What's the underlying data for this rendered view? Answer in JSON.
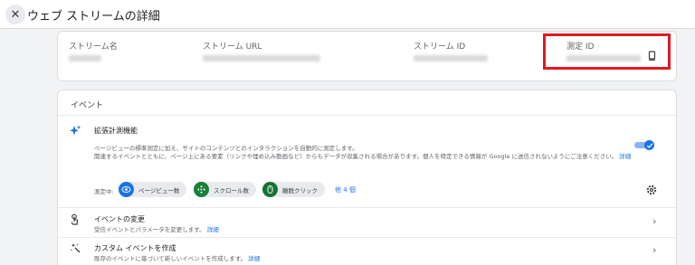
{
  "header": {
    "title": "ウェブ ストリームの詳細",
    "close_icon": "close-icon"
  },
  "stream": {
    "fields": [
      {
        "label": "ストリーム名"
      },
      {
        "label": "ストリーム URL"
      },
      {
        "label": "ストリーム ID"
      },
      {
        "label": "測定 ID"
      }
    ]
  },
  "events": {
    "title": "イベント",
    "enhanced": {
      "title": "拡張計測機能",
      "desc1": "ページビューの標準測定に加え、サイトのコンテンツとのインタラクションを自動的に測定します。",
      "desc2": "関連するイベントとともに、ページ上にある要素（リンクや埋め込み動画など）からもデータが収集される場合があります。個人を特定できる情報が Google に送信されないようにご注意ください。",
      "detail_link": "詳細",
      "toggle_on": true,
      "measuring_label": "測定中:",
      "chips": [
        {
          "label": "ページビュー数",
          "icon": "eye-icon",
          "color": "#1a73e8"
        },
        {
          "label": "スクロール数",
          "icon": "move-icon",
          "color": "#188038"
        },
        {
          "label": "離脱クリック",
          "icon": "mouse-icon",
          "color": "#137333"
        }
      ],
      "more_link": "他 4 個"
    },
    "modify": {
      "title": "イベントの変更",
      "desc": "受信イベントとパラメータを変更します。",
      "link": "詳細"
    },
    "create": {
      "title": "カスタム イベントを作成",
      "desc": "既存のイベントに基づいて新しいイベントを作成します。",
      "link": "詳細"
    }
  }
}
